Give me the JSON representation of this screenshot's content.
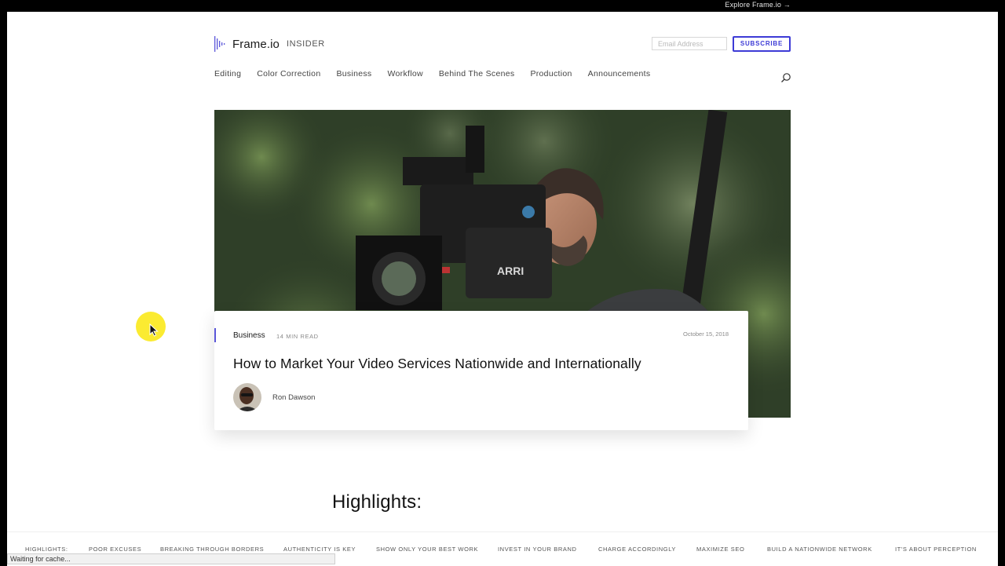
{
  "topbar": {
    "explore_link": "Explore Frame.io →"
  },
  "header": {
    "brand": "Frame.io",
    "sub_brand": "INSIDER",
    "email_placeholder": "Email Address",
    "subscribe_label": "SUBSCRIBE"
  },
  "nav": {
    "items": [
      "Editing",
      "Color Correction",
      "Business",
      "Workflow",
      "Behind The Scenes",
      "Production",
      "Announcements"
    ]
  },
  "icons": {
    "logo": "frameio-logo-icon",
    "search": "search-icon",
    "cursor": "mouse-pointer-icon"
  },
  "article": {
    "category": "Business",
    "read_time": "14 MIN READ",
    "date": "October 15, 2018",
    "title": "How to Market Your Video Services Nationwide and Internationally",
    "author": "Ron Dawson"
  },
  "highlights": {
    "heading": "Highlights:",
    "bar": [
      "HIGHLIGHTS:",
      "POOR EXCUSES",
      "BREAKING THROUGH BORDERS",
      "AUTHENTICITY IS KEY",
      "SHOW ONLY YOUR BEST WORK",
      "INVEST IN YOUR BRAND",
      "CHARGE ACCORDINGLY",
      "MAXIMIZE SEO",
      "BUILD A NATIONWIDE NETWORK",
      "IT'S ABOUT PERCEPTION"
    ]
  },
  "status_bar": {
    "text": "Waiting for cache..."
  },
  "colors": {
    "accent": "#3d3bd6",
    "cursor_highlight": "#fae814"
  }
}
